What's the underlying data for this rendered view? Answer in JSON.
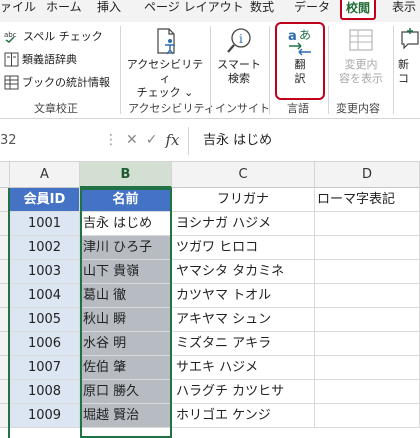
{
  "tabs": [
    "ァイル",
    "ホーム",
    "挿入",
    "ページ レイアウト",
    "数式",
    "データ",
    "校閲",
    "表示"
  ],
  "ribbon": {
    "proofing": {
      "spell": "スペル チェック",
      "thesaurus": "類義語辞典",
      "stats": "ブックの統計情報",
      "group_label": "文章校正"
    },
    "accessibility": {
      "button": [
        "アクセシビリティ",
        "チェック ⌄"
      ],
      "group_label": "アクセシビリティ"
    },
    "insights": {
      "button": [
        "スマート",
        "検索"
      ],
      "group_label": "インサイト"
    },
    "language": {
      "button": [
        "翻",
        "訳"
      ],
      "group_label": "言語"
    },
    "changes": {
      "button": [
        "変更内",
        "容を表示"
      ],
      "group_label": "変更内容"
    },
    "new_comment": [
      "新",
      "コ"
    ]
  },
  "formula_bar": {
    "name_box": "32",
    "fx": "fx",
    "formula": "吉永 はじめ"
  },
  "grid": {
    "columns": [
      "A",
      "B",
      "C",
      "D"
    ],
    "header_row": [
      "会員ID",
      "名前",
      "フリガナ",
      "ローマ字表記"
    ],
    "rows": [
      [
        "1001",
        "吉永 はじめ",
        "ヨシナガ ハジメ",
        ""
      ],
      [
        "1002",
        "津川 ひろ子",
        "ツガワ ヒロコ",
        ""
      ],
      [
        "1003",
        "山下 貴嶺",
        "ヤマシタ タカミネ",
        ""
      ],
      [
        "1004",
        "葛山 徹",
        "カツヤマ トオル",
        ""
      ],
      [
        "1005",
        "秋山 瞬",
        "アキヤマ シュン",
        ""
      ],
      [
        "1006",
        "水谷 明",
        "ミズタニ アキラ",
        ""
      ],
      [
        "1007",
        "佐伯 肇",
        "サエキ ハジメ",
        ""
      ],
      [
        "1008",
        "原口 勝久",
        "ハラグチ カツヒサ",
        ""
      ],
      [
        "1009",
        "堀越 賢治",
        "ホリゴエ ケンジ",
        ""
      ]
    ]
  },
  "colors": {
    "active_tab": "#1e6b35",
    "highlight_outline": "#c0001a",
    "header_fill": "#4472c4",
    "selection": "#217346"
  }
}
